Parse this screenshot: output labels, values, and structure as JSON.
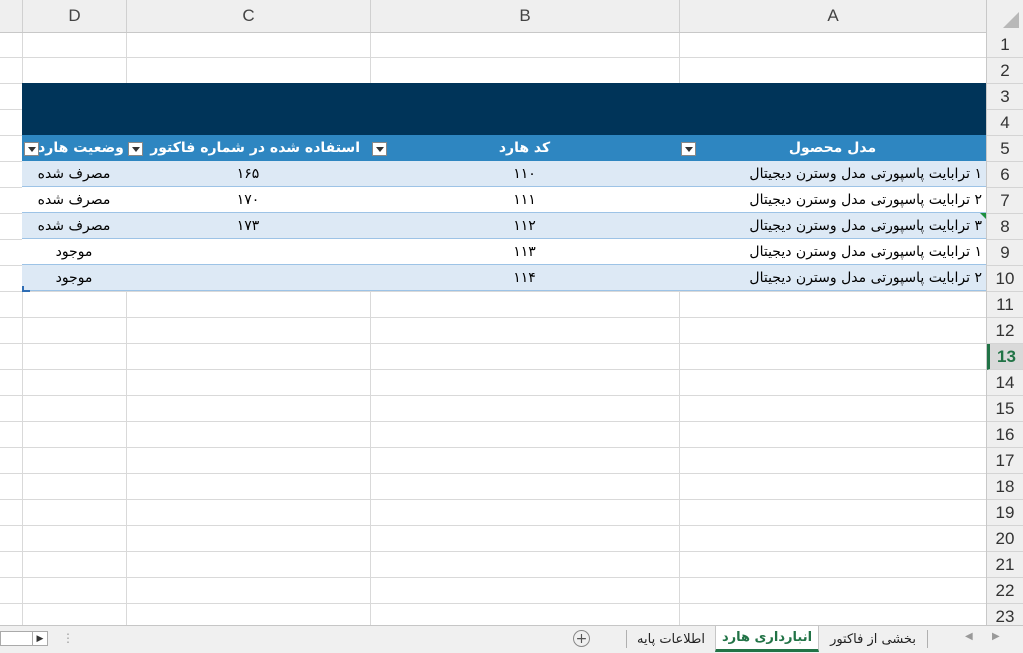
{
  "columns": [
    "D",
    "C",
    "B",
    "A"
  ],
  "rows": [
    "1",
    "2",
    "3",
    "4",
    "5",
    "6",
    "7",
    "8",
    "9",
    "10",
    "11",
    "12",
    "13",
    "14",
    "15",
    "16",
    "17",
    "18",
    "19",
    "20",
    "21",
    "22",
    "23"
  ],
  "selected_row": "13",
  "table": {
    "headers": {
      "product_location": "مدل محصول",
      "hard_code": "کد هارد",
      "used_invoice": "استفاده شده در شماره  فاکتور",
      "hard_status": "وضعیت هارد"
    },
    "rows": [
      {
        "product": "۱ ترابایت پاسپورتی مدل وسترن دیجیتال",
        "code": "۱۱۰",
        "invoice": "۱۶۵",
        "status": "مصرف شده"
      },
      {
        "product": "۲ ترابایت پاسپورتی مدل وسترن دیجیتال",
        "code": "۱۱۱",
        "invoice": "۱۷۰",
        "status": "مصرف شده"
      },
      {
        "product": "۳ ترابایت پاسپورتی مدل وسترن دیجیتال",
        "code": "۱۱۲",
        "invoice": "۱۷۳",
        "status": "مصرف شده"
      },
      {
        "product": "۱ ترابایت پاسپورتی مدل وسترن دیجیتال",
        "code": "۱۱۳",
        "invoice": "",
        "status": "موجود"
      },
      {
        "product": "۲ ترابایت پاسپورتی مدل وسترن دیجیتال",
        "code": "۱۱۴",
        "invoice": "",
        "status": "موجود"
      }
    ]
  },
  "sheet_tabs": {
    "invoice_part": "بخشی از فاکتور",
    "hard_inventory": "انبارداری هارد",
    "base_info": "اطلاعات پایه"
  },
  "icons": {
    "add_sheet": "plus-circle-icon",
    "scroll_right": "triangle-right-icon"
  },
  "colors": {
    "title_band": "#003459",
    "header_fill": "#2e86c1",
    "band_fill": "#dde9f5",
    "accent": "#217346"
  }
}
